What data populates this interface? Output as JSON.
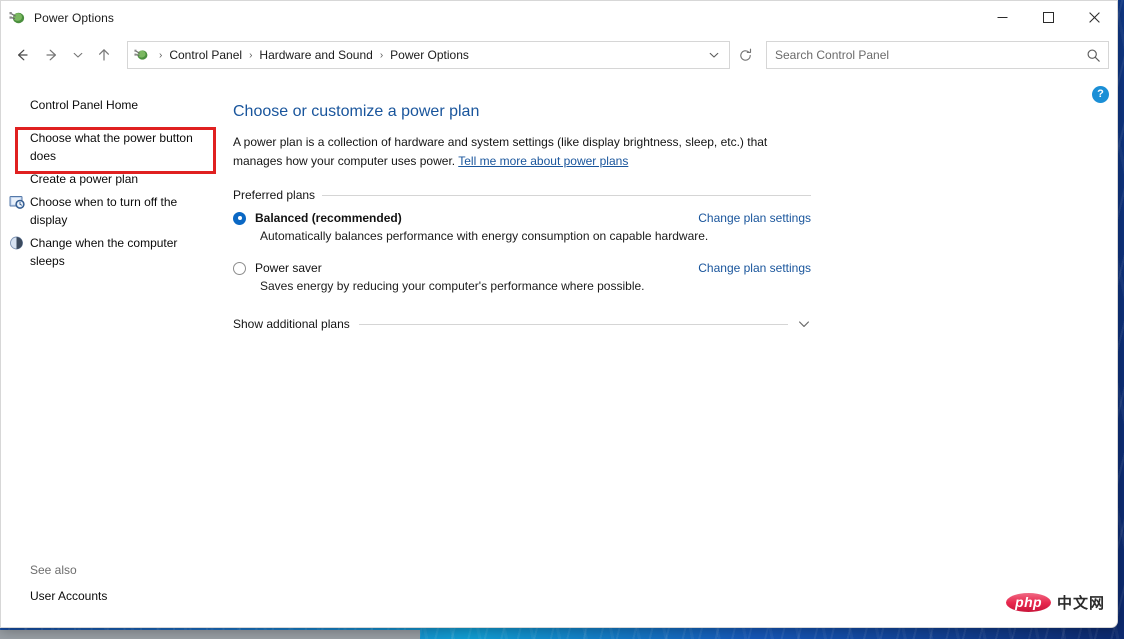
{
  "window": {
    "title": "Power Options",
    "title_icon": "power-plug-icon",
    "controls": {
      "minimize": "minimize-icon",
      "maximize": "maximize-icon",
      "close": "close-icon"
    }
  },
  "navbar": {
    "back": "back-arrow-icon",
    "forward": "forward-arrow-icon",
    "recent": "chevron-down-icon",
    "up": "up-arrow-icon",
    "address_icon": "power-plug-icon",
    "breadcrumbs": [
      "Control Panel",
      "Hardware and Sound",
      "Power Options"
    ],
    "separator": "›",
    "dropdown": "chevron-down-icon",
    "refresh": "refresh-icon"
  },
  "search": {
    "placeholder": "Search Control Panel",
    "value": "",
    "icon": "search-icon"
  },
  "sidebar": {
    "home": {
      "label": "Control Panel Home",
      "icon": null
    },
    "items": [
      {
        "label": "Choose what the power button does",
        "icon": null,
        "highlighted": true
      },
      {
        "label": "Create a power plan",
        "icon": null,
        "highlighted": false
      },
      {
        "label": "Choose when to turn off the display",
        "icon": "display-clock-icon",
        "highlighted": false
      },
      {
        "label": "Change when the computer sleeps",
        "icon": "moon-sleep-icon",
        "highlighted": false
      }
    ],
    "see_also": {
      "title": "See also",
      "links": [
        "User Accounts"
      ]
    },
    "highlight_color": "#e02020"
  },
  "main": {
    "help_button": {
      "label": "?",
      "icon": "help-icon"
    },
    "title": "Choose or customize a power plan",
    "intro_text": "A power plan is a collection of hardware and system settings (like display brightness, sleep, etc.) that manages how your computer uses power. ",
    "intro_link": "Tell me more about power plans",
    "preferred_plans_label": "Preferred plans",
    "plans": [
      {
        "name": "Balanced (recommended)",
        "selected": true,
        "description": "Automatically balances performance with energy consumption on capable hardware.",
        "settings_link": "Change plan settings"
      },
      {
        "name": "Power saver",
        "selected": false,
        "description": "Saves energy by reducing your computer's performance where possible.",
        "settings_link": "Change plan settings"
      }
    ],
    "show_additional_plans": "Show additional plans",
    "show_additional_icon": "chevron-down-icon",
    "link_color": "#19559c",
    "accent_color": "#0b68c4"
  },
  "watermark": {
    "badge": "php",
    "text": "中文网"
  }
}
